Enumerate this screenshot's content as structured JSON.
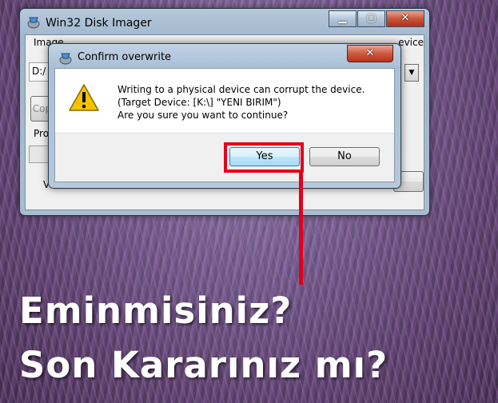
{
  "main_window": {
    "title": "Win32 Disk Imager",
    "label_image_file": "Image File",
    "label_device": "Device",
    "image_path": "D:/",
    "copy_button": "Copy",
    "progress_label": "Progress",
    "version_label": "Version"
  },
  "dialog": {
    "title": "Confirm overwrite",
    "close_symbol": "✕",
    "message_lines": [
      "Writing to a physical device can corrupt the device.",
      "(Target Device: [K:\\] \"YENI BIRIM\")",
      "Are you sure you want to continue?"
    ],
    "yes_label": "Yes",
    "no_label": "No"
  },
  "overlay": {
    "line1": "Eminmisiniz?",
    "line2": "Son Kararınız mı?",
    "highlight_color": "#e3001b"
  }
}
